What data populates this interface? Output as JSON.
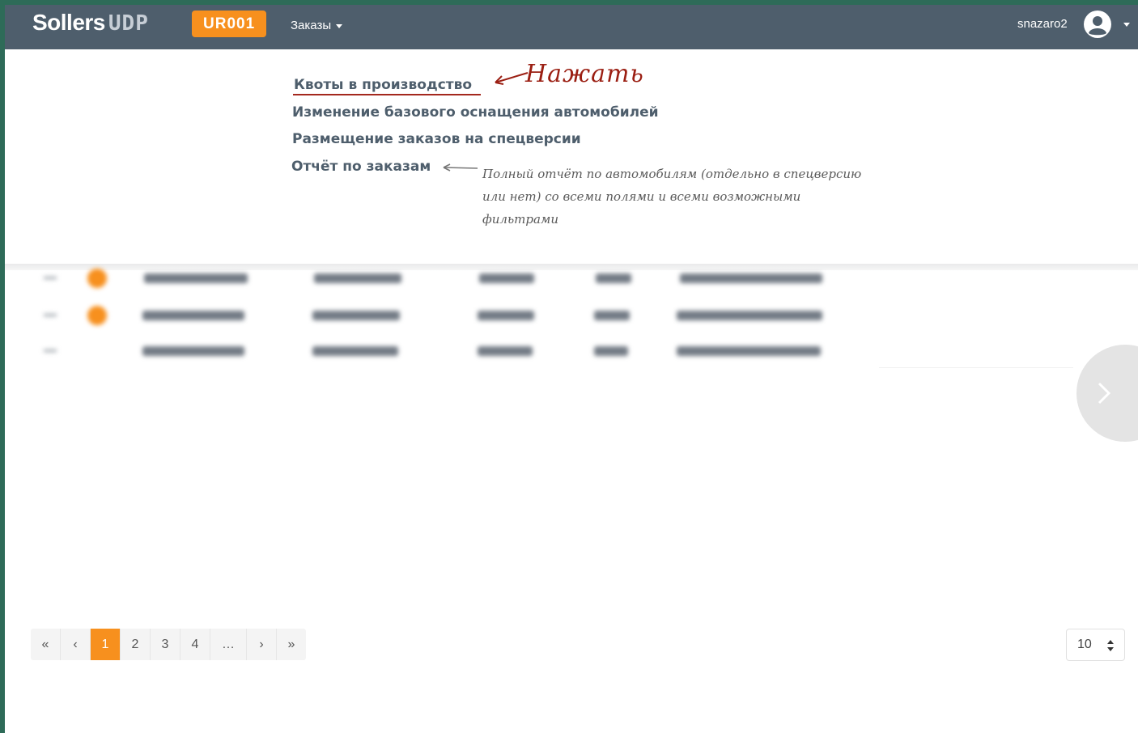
{
  "header": {
    "brand_main": "Sollers",
    "brand_sub": "UDP",
    "dealer_code": "UR001",
    "orders_menu_label": "Заказы",
    "username": "snazaro2"
  },
  "orders_menu": {
    "items": [
      {
        "label": "Квоты в производство"
      },
      {
        "label": "Изменение базового оснащения автомобилей"
      },
      {
        "label": "Размещение заказов на спецверсии"
      },
      {
        "label": "Отчёт по заказам"
      }
    ]
  },
  "annotations": {
    "click_note": "Нажать",
    "report_note": "Полный отчёт по автомобилям (отдельно в спецверсию или нет) со всеми полями и всеми возможными фильтрами"
  },
  "pagination": {
    "first": "«",
    "prev": "‹",
    "pages": [
      "1",
      "2",
      "3",
      "4",
      "…"
    ],
    "active_page": "1",
    "next": "›",
    "last": "»"
  },
  "page_size": {
    "value": "10"
  },
  "colors": {
    "navbar": "#4e5e6c",
    "accent": "#f7901e",
    "annotation_red": "#9b1f13"
  }
}
